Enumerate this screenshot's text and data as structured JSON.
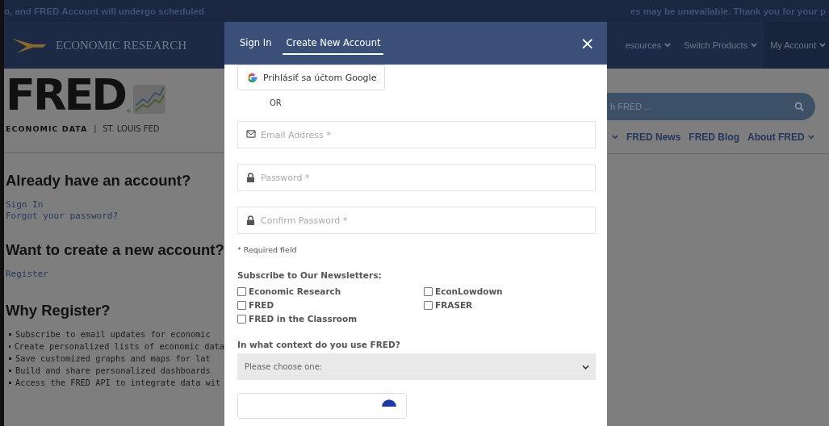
{
  "banner": {
    "left_text": "o, and FRED Account will undergo scheduled",
    "right_text": "es may be unavailable. Thank you for your p"
  },
  "header": {
    "brand": "ECONOMIC RESEARCH",
    "menu": [
      {
        "label": "esources",
        "selected": false
      },
      {
        "label": "Switch Products",
        "selected": false
      },
      {
        "label": "My Account",
        "selected": true
      }
    ]
  },
  "logo": {
    "wordmark": "FRED",
    "registered": "®",
    "tagline_left": "ECONOMIC DATA",
    "separator": "|",
    "tagline_right": "ST. LOUIS FED"
  },
  "search": {
    "placeholder": "h FRED ..."
  },
  "sub_nav": [
    {
      "label": "FRED News",
      "dropdown": false
    },
    {
      "label": "FRED Blog",
      "dropdown": false
    },
    {
      "label": "About FRED",
      "dropdown": true
    }
  ],
  "content": {
    "signin_heading": "Already have an account?",
    "signin_link": "Sign In",
    "forgot_link": "Forgot your password?",
    "create_heading": "Want to create a new account?",
    "register_link": "Register",
    "why_heading": "Why Register?",
    "bullets": [
      "Subscribe to email updates for economic",
      "Create personalized lists of economic data",
      "Save customized graphs and maps for lat",
      "Build and share personalized dashboards",
      "Access the FRED API to integrate data wit"
    ]
  },
  "modal": {
    "tabs": [
      {
        "label": "Sign In",
        "selected": false
      },
      {
        "label": "Create New Account",
        "selected": true
      }
    ],
    "close": "×",
    "google_button": "Prihlásiť sa účtom Google",
    "or_text": "OR",
    "fields": [
      {
        "kind": "email",
        "placeholder": "Email Address *"
      },
      {
        "kind": "password",
        "placeholder": "Password *"
      },
      {
        "kind": "password",
        "placeholder": "Confirm Password *"
      }
    ],
    "required_note": "* Required field",
    "newsletters": {
      "title": "Subscribe to Our Newsletters:",
      "options": [
        {
          "label": "Economic Research",
          "checked": false
        },
        {
          "label": "EconLowdown",
          "checked": false
        },
        {
          "label": "FRED",
          "checked": false
        },
        {
          "label": "FRASER",
          "checked": false
        },
        {
          "label": "FRED in the Classroom",
          "checked": false
        }
      ]
    },
    "context": {
      "label": "In what context do you use FRED?",
      "placeholder": "Please choose one:"
    }
  }
}
